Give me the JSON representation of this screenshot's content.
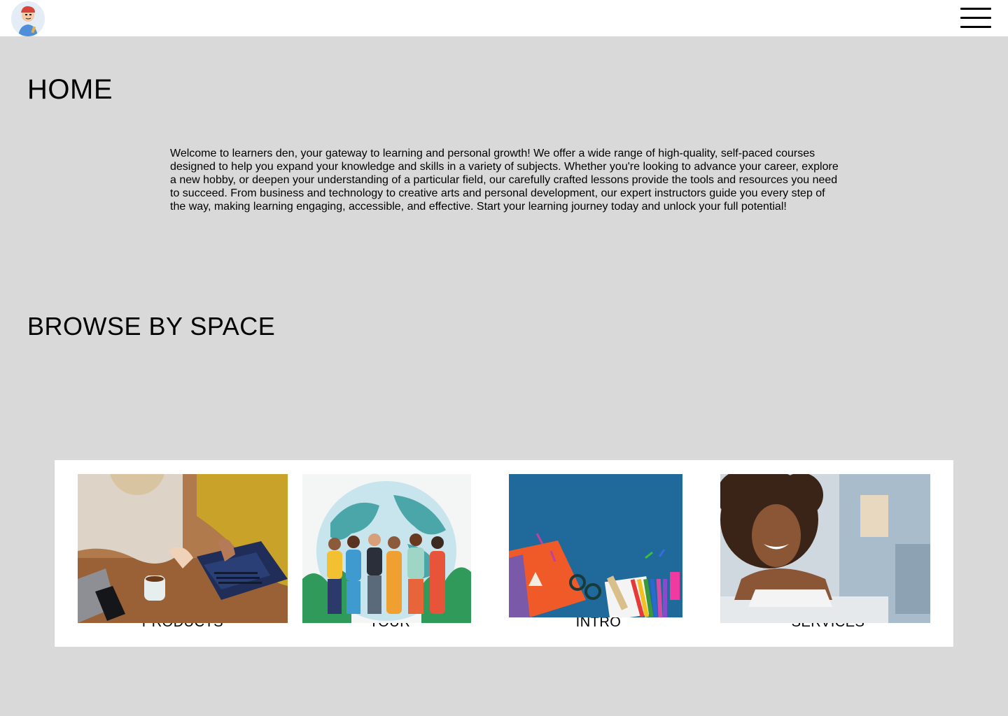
{
  "header": {
    "logo_icon": "cartoon-avatar-logo",
    "menu_icon": "hamburger-menu-icon"
  },
  "home": {
    "title": "HOME",
    "intro": "Welcome to learners den, your gateway to learning and personal growth! We offer a wide range of high-quality, self-paced courses designed to help you expand your knowledge and skills in a variety of subjects. Whether you're looking to advance your career, explore a new hobby, or deepen your understanding of a particular field, our carefully crafted lessons provide the tools and resources you need to succeed. From business and technology to creative arts and personal development, our expert instructors guide you every step of the way, making learning engaging, accessible, and effective. Start your learning journey today and unlock your full potential!"
  },
  "browse": {
    "title": "BROWSE BY SPACE",
    "cards": [
      {
        "label": "PRODUCTS",
        "image": "people-with-laptop-photo"
      },
      {
        "label": "TOUR",
        "image": "students-globe-illustration"
      },
      {
        "label": "INTRO",
        "image": "school-supplies-photo"
      },
      {
        "label": "SERVICES",
        "image": "smiling-woman-photo"
      }
    ]
  },
  "colors": {
    "page_background": "#d9d9d9",
    "header_background": "#ffffff",
    "panel_background": "#ffffff"
  }
}
